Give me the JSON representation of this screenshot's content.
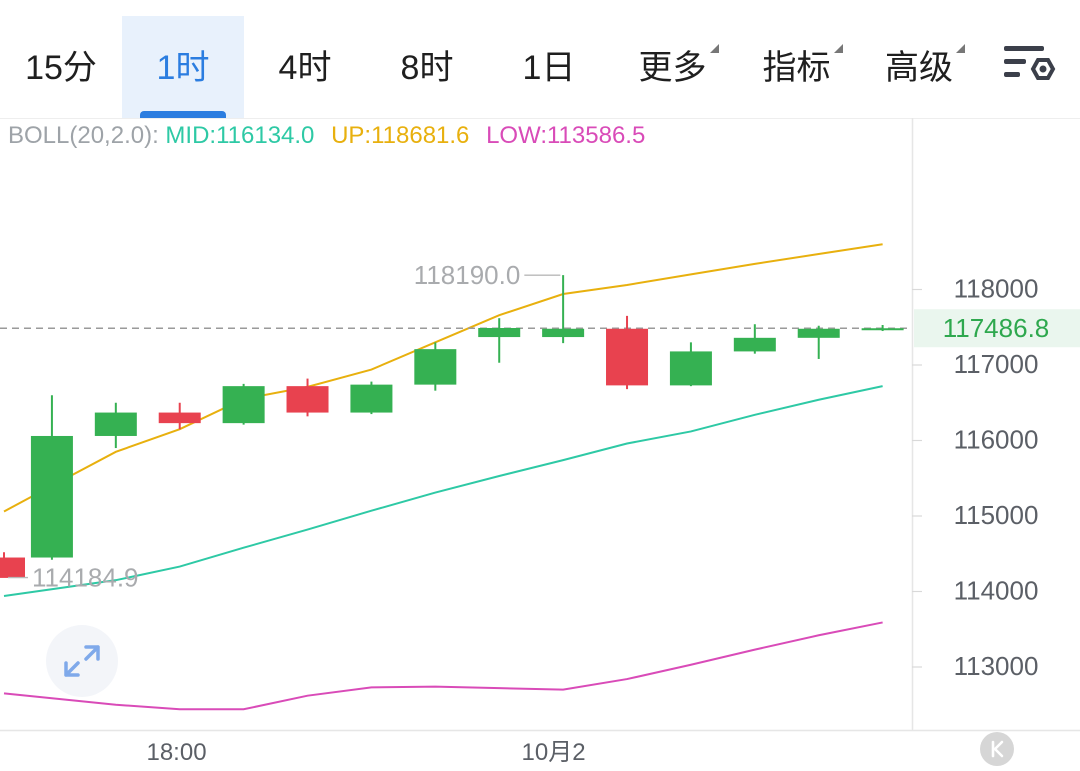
{
  "tabs": [
    {
      "label": "15分",
      "active": false,
      "dropdown": false
    },
    {
      "label": "1时",
      "active": true,
      "dropdown": false
    },
    {
      "label": "4时",
      "active": false,
      "dropdown": false
    },
    {
      "label": "8时",
      "active": false,
      "dropdown": false
    },
    {
      "label": "1日",
      "active": false,
      "dropdown": false
    },
    {
      "label": "更多",
      "active": false,
      "dropdown": true
    },
    {
      "label": "指标",
      "active": false,
      "dropdown": true
    },
    {
      "label": "高级",
      "active": false,
      "dropdown": true
    }
  ],
  "settings_icon": "chart-settings-icon",
  "expand_icon": "expand-icon",
  "scroll_icon": "scroll-to-latest-icon",
  "indicator": {
    "name": "BOLL(20,2.0):",
    "mid_label": "MID:116134.0",
    "up_label": "UP:118681.6",
    "low_label": "LOW:113586.5"
  },
  "colors": {
    "up_candle": "#35b152",
    "down_candle": "#e8424f",
    "boll_mid": "#2ec9a5",
    "boll_up": "#e8b00e",
    "boll_low": "#d94bb8",
    "last_price_text": "#2ea84e",
    "last_price_bg": "#eaf6ee",
    "active_tab": "#2b7de0"
  },
  "chart_data": {
    "type": "candlestick",
    "y_ticks": [
      118000,
      117000,
      116000,
      115000,
      114000,
      113000
    ],
    "x_ticks": [
      {
        "label": "18:00",
        "index": 2.7
      },
      {
        "label": "10月2",
        "index": 8.6
      }
    ],
    "last_price": "117486.8",
    "last_price_value": 117486.8,
    "high_marker": {
      "label": "118190.0",
      "value": 118190.0,
      "index": 8.8
    },
    "low_marker": {
      "label": "114184.9",
      "value": 114184.9,
      "index": 0
    },
    "candles": [
      {
        "i": 0,
        "open": 114450,
        "close": 114180,
        "high": 114520,
        "low": 114184.9
      },
      {
        "i": 0.75,
        "open": 114450,
        "close": 116060,
        "high": 116600,
        "low": 114420
      },
      {
        "i": 1.75,
        "open": 116060,
        "close": 116370,
        "high": 116500,
        "low": 115900
      },
      {
        "i": 2.75,
        "open": 116370,
        "close": 116230,
        "high": 116500,
        "low": 116150
      },
      {
        "i": 3.75,
        "open": 116230,
        "close": 116720,
        "high": 116750,
        "low": 116210
      },
      {
        "i": 4.75,
        "open": 116720,
        "close": 116370,
        "high": 116820,
        "low": 116320
      },
      {
        "i": 5.75,
        "open": 116370,
        "close": 116740,
        "high": 116780,
        "low": 116350
      },
      {
        "i": 6.75,
        "open": 116740,
        "close": 117210,
        "high": 117300,
        "low": 116660
      },
      {
        "i": 7.75,
        "open": 117370,
        "close": 117490,
        "high": 117620,
        "low": 117030
      },
      {
        "i": 8.75,
        "open": 117370,
        "close": 117480,
        "high": 118190,
        "low": 117290
      },
      {
        "i": 9.75,
        "open": 117480,
        "close": 116730,
        "high": 117650,
        "low": 116680
      },
      {
        "i": 10.75,
        "open": 116730,
        "close": 117180,
        "high": 117300,
        "low": 116720
      },
      {
        "i": 11.75,
        "open": 117180,
        "close": 117360,
        "high": 117540,
        "low": 117150
      },
      {
        "i": 12.75,
        "open": 117360,
        "close": 117480,
        "high": 117520,
        "low": 117080
      },
      {
        "i": 13.75,
        "open": 117480,
        "close": 117486.8,
        "high": 117530,
        "low": 117450
      }
    ],
    "series": [
      {
        "name": "UP",
        "points": [
          [
            0,
            115060
          ],
          [
            0.75,
            115400
          ],
          [
            1.75,
            115850
          ],
          [
            2.75,
            116150
          ],
          [
            3.75,
            116550
          ],
          [
            4.75,
            116710
          ],
          [
            5.75,
            116940
          ],
          [
            6.75,
            117300
          ],
          [
            7.75,
            117660
          ],
          [
            8.75,
            117940
          ],
          [
            9.75,
            118060
          ],
          [
            10.75,
            118200
          ],
          [
            11.75,
            118340
          ],
          [
            12.75,
            118470
          ],
          [
            13.75,
            118600
          ]
        ]
      },
      {
        "name": "MID",
        "points": [
          [
            0,
            113940
          ],
          [
            1.75,
            114150
          ],
          [
            2.75,
            114330
          ],
          [
            3.75,
            114580
          ],
          [
            4.75,
            114820
          ],
          [
            5.75,
            115070
          ],
          [
            6.75,
            115310
          ],
          [
            7.75,
            115530
          ],
          [
            8.75,
            115740
          ],
          [
            9.75,
            115960
          ],
          [
            10.75,
            116120
          ],
          [
            11.75,
            116340
          ],
          [
            12.75,
            116540
          ],
          [
            13.75,
            116720
          ]
        ]
      },
      {
        "name": "LOW",
        "points": [
          [
            0,
            112650
          ],
          [
            1.75,
            112500
          ],
          [
            2.75,
            112440
          ],
          [
            3.75,
            112440
          ],
          [
            4.75,
            112620
          ],
          [
            5.75,
            112730
          ],
          [
            6.75,
            112740
          ],
          [
            7.75,
            112720
          ],
          [
            8.75,
            112700
          ],
          [
            9.75,
            112840
          ],
          [
            10.75,
            113030
          ],
          [
            11.75,
            113230
          ],
          [
            12.75,
            113420
          ],
          [
            13.75,
            113590
          ]
        ]
      }
    ],
    "ylim": [
      112200,
      119500
    ],
    "grid": true
  }
}
